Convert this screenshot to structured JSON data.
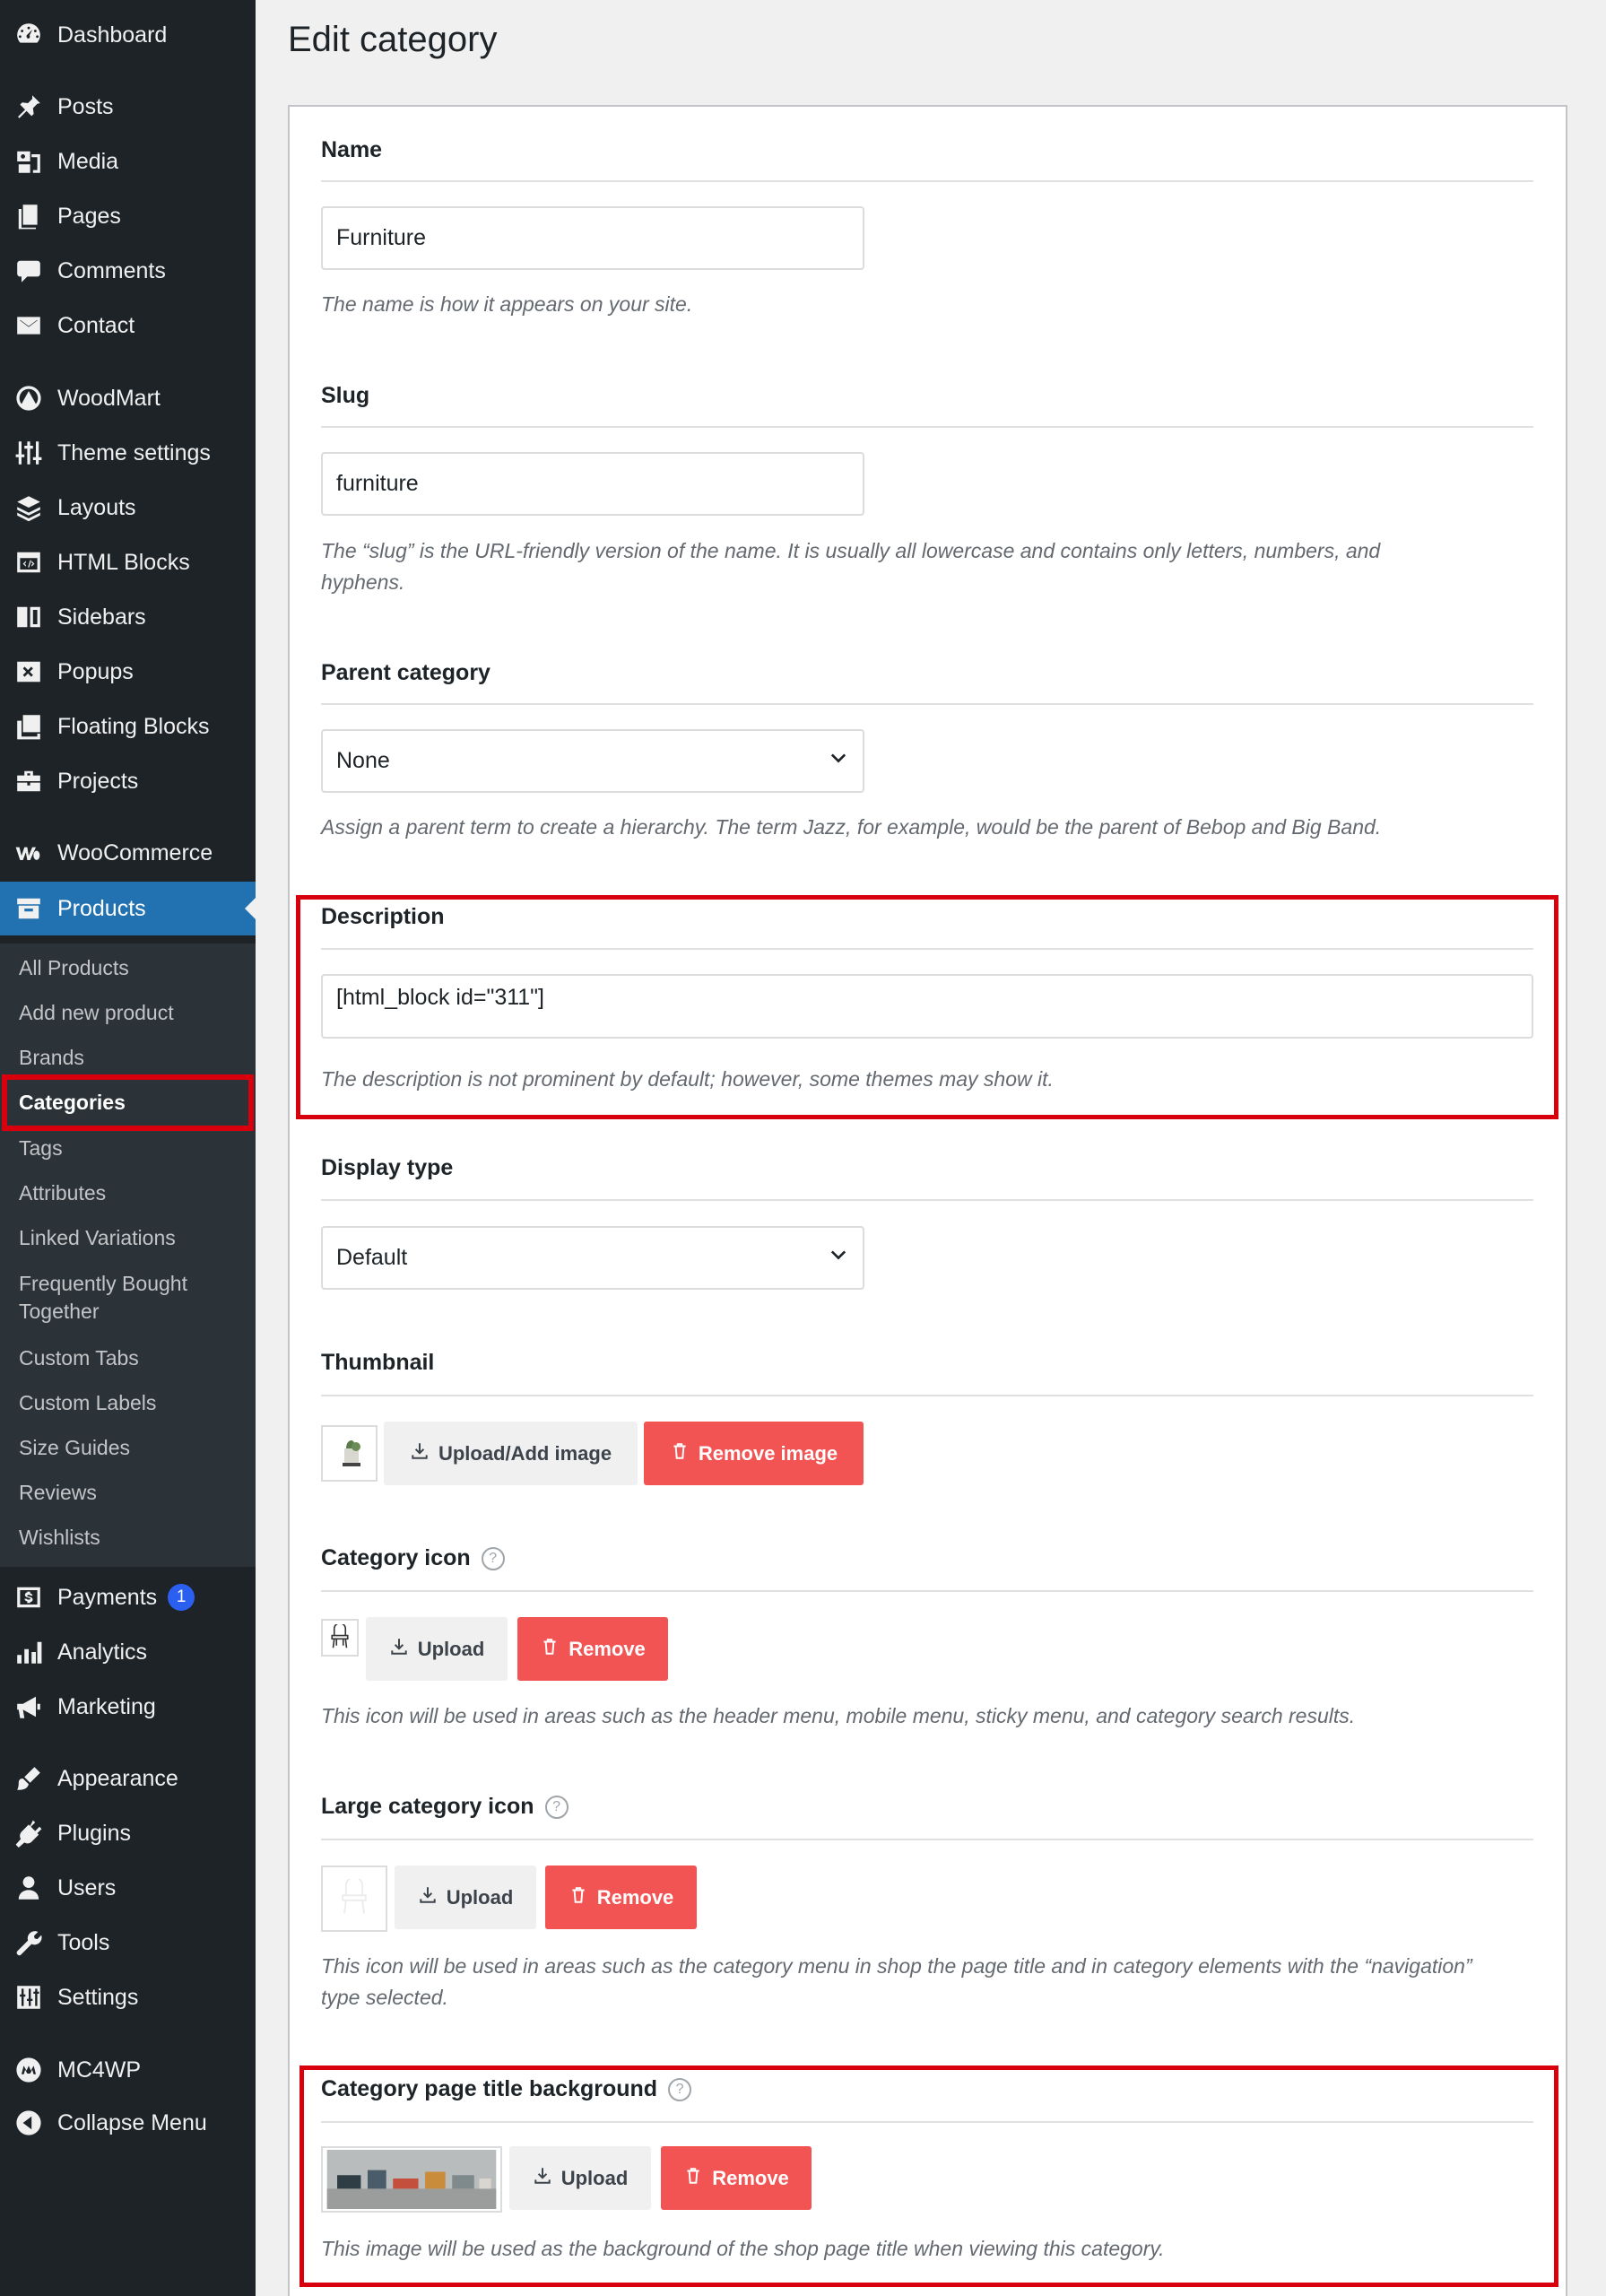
{
  "sidebar": {
    "top_items": [
      {
        "label": "Dashboard",
        "icon": "dashboard-icon"
      },
      {
        "label": "Posts",
        "icon": "pin-icon"
      },
      {
        "label": "Media",
        "icon": "media-icon"
      },
      {
        "label": "Pages",
        "icon": "pages-icon"
      },
      {
        "label": "Comments",
        "icon": "comment-icon"
      },
      {
        "label": "Contact",
        "icon": "mail-icon"
      },
      {
        "label": "WoodMart",
        "icon": "woodmart-icon"
      },
      {
        "label": "Theme settings",
        "icon": "sliders-icon"
      },
      {
        "label": "Layouts",
        "icon": "layers-icon"
      },
      {
        "label": "HTML Blocks",
        "icon": "code-icon"
      },
      {
        "label": "Sidebars",
        "icon": "sidebar-icon"
      },
      {
        "label": "Popups",
        "icon": "popup-icon"
      },
      {
        "label": "Floating Blocks",
        "icon": "floating-icon"
      },
      {
        "label": "Projects",
        "icon": "briefcase-icon"
      },
      {
        "label": "WooCommerce",
        "icon": "woo-icon"
      },
      {
        "label": "Products",
        "icon": "archive-icon"
      }
    ],
    "submenu": [
      "All Products",
      "Add new product",
      "Brands",
      "Categories",
      "Tags",
      "Attributes",
      "Linked Variations",
      "Frequently Bought Together",
      "Custom Tabs",
      "Custom Labels",
      "Size Guides",
      "Reviews",
      "Wishlists"
    ],
    "bottom_items": [
      {
        "label": "Payments",
        "icon": "payments-icon",
        "badge": "1"
      },
      {
        "label": "Analytics",
        "icon": "analytics-icon"
      },
      {
        "label": "Marketing",
        "icon": "megaphone-icon"
      },
      {
        "label": "Appearance",
        "icon": "brush-icon"
      },
      {
        "label": "Plugins",
        "icon": "plug-icon"
      },
      {
        "label": "Users",
        "icon": "user-icon"
      },
      {
        "label": "Tools",
        "icon": "wrench-icon"
      },
      {
        "label": "Settings",
        "icon": "settings-icon"
      },
      {
        "label": "MC4WP",
        "icon": "mc4wp-icon"
      },
      {
        "label": "Collapse Menu",
        "icon": "collapse-icon"
      }
    ]
  },
  "page": {
    "title": "Edit category"
  },
  "form": {
    "name": {
      "label": "Name",
      "value": "Furniture",
      "help": "The name is how it appears on your site."
    },
    "slug": {
      "label": "Slug",
      "value": "furniture",
      "help": "The “slug” is the URL-friendly version of the name. It is usually all lowercase and contains only letters, numbers, and hyphens."
    },
    "parent": {
      "label": "Parent category",
      "value": "None",
      "help": "Assign a parent term to create a hierarchy. The term Jazz, for example, would be the parent of Bebop and Big Band."
    },
    "description": {
      "label": "Description",
      "value": "[html_block id=\"311\"]",
      "help": "The description is not prominent by default; however, some themes may show it."
    },
    "display_type": {
      "label": "Display type",
      "value": "Default"
    },
    "thumbnail": {
      "label": "Thumbnail",
      "upload_label": "Upload/Add image",
      "remove_label": "Remove image"
    },
    "category_icon": {
      "label": "Category icon",
      "help_mark": "?",
      "upload_label": "Upload",
      "remove_label": "Remove",
      "help": "This icon will be used in areas such as the header menu, mobile menu, sticky menu, and category search results."
    },
    "large_icon": {
      "label": "Large category icon",
      "help_mark": "?",
      "upload_label": "Upload",
      "remove_label": "Remove",
      "help": "This icon will be used in areas such as the category menu in shop the page title and in category elements with the “navigation” type selected."
    },
    "title_bg": {
      "label": "Category page title background",
      "help_mark": "?",
      "upload_label": "Upload",
      "remove_label": "Remove",
      "help": "This image will be used as the background of the shop page title when viewing this category."
    }
  },
  "colors": {
    "sidebar_bg": "#1d2327",
    "active_bg": "#2271b1",
    "highlight": "#d9000d",
    "remove_btn": "#f25353",
    "badge": "#2b5ff0"
  }
}
